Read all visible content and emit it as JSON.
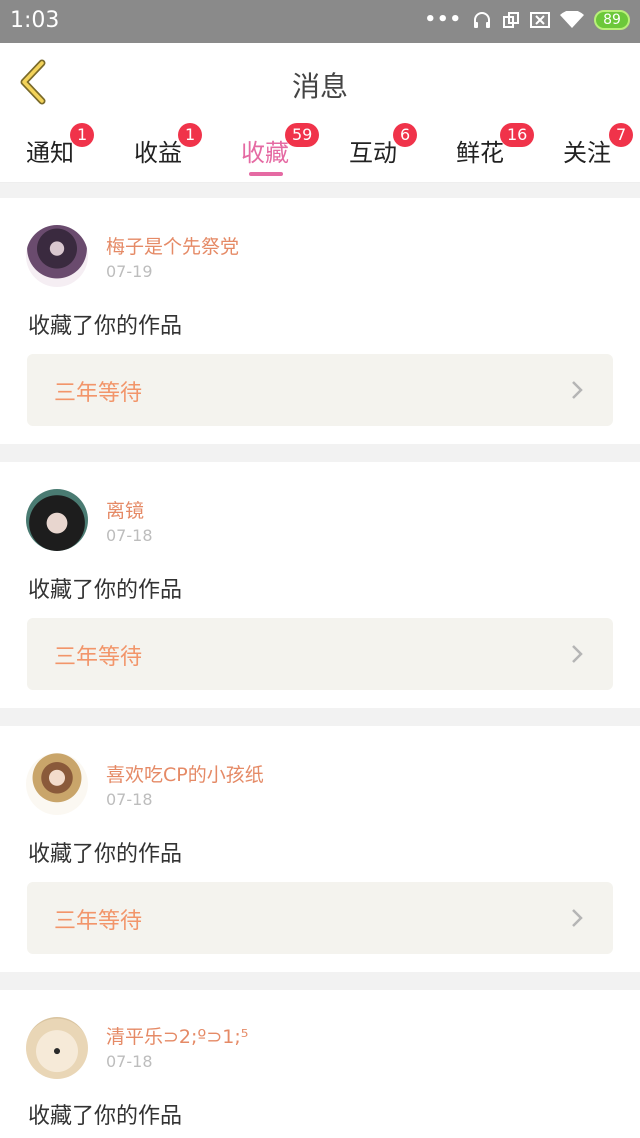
{
  "status_bar": {
    "time": "1:03",
    "battery": "89"
  },
  "nav": {
    "title": "消息"
  },
  "tabs": [
    {
      "label": "通知",
      "badge": "1"
    },
    {
      "label": "收益",
      "badge": "1"
    },
    {
      "label": "收藏",
      "badge": "59",
      "active": true
    },
    {
      "label": "互动",
      "badge": "6"
    },
    {
      "label": "鲜花",
      "badge": "16"
    },
    {
      "label": "关注",
      "badge": "7"
    }
  ],
  "messages": [
    {
      "user": "梅子是个先祭党",
      "date": "07-19",
      "action": "收藏了你的作品",
      "work": "三年等待"
    },
    {
      "user": "离镜",
      "date": "07-18",
      "action": "收藏了你的作品",
      "work": "三年等待"
    },
    {
      "user": "喜欢吃CP的小孩纸",
      "date": "07-18",
      "action": "收藏了你的作品",
      "work": "三年等待"
    },
    {
      "user": "清平乐⊃2;º⊃1;⁵",
      "date": "07-18",
      "action": "收藏了你的作品"
    }
  ],
  "colors": {
    "accent": "#e56aa3",
    "badge": "#f0334a",
    "username": "#e58a66",
    "work_title": "#f2956a"
  }
}
